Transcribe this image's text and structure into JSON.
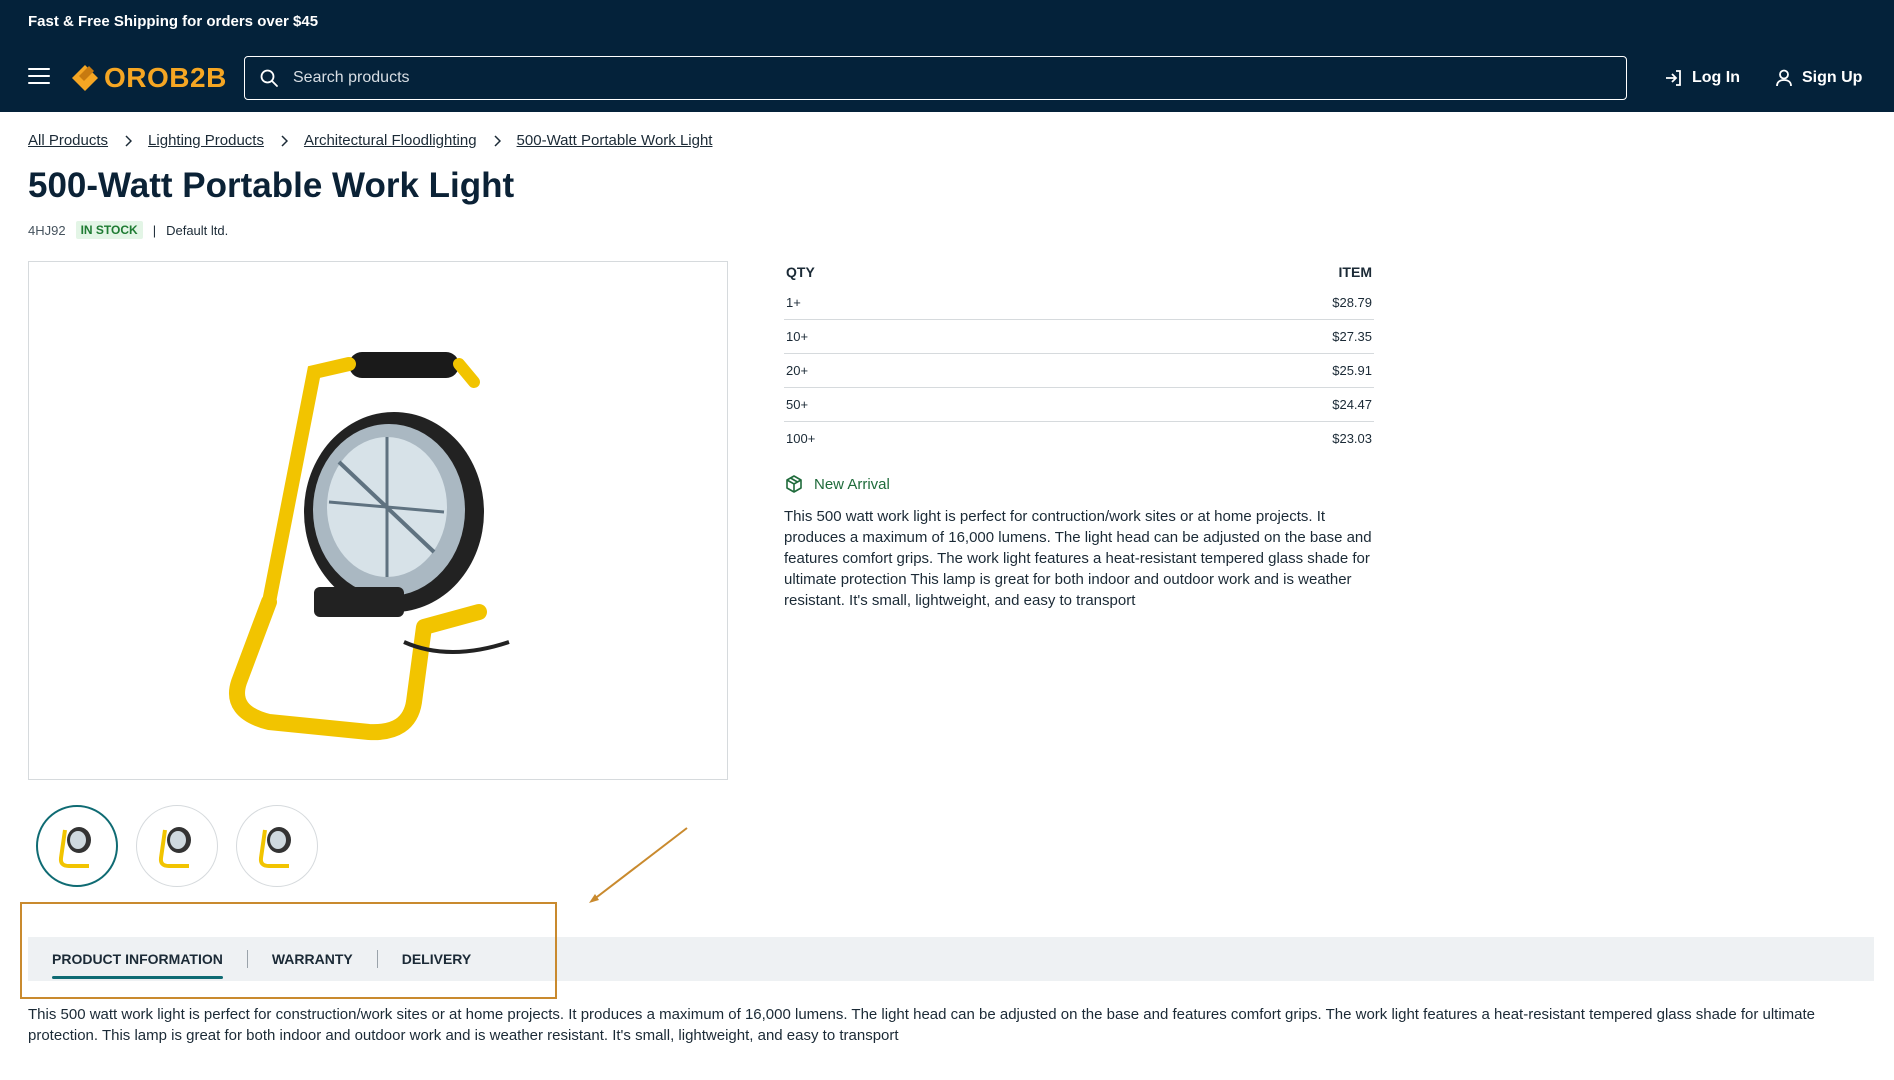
{
  "header": {
    "promo": "Fast & Free Shipping for orders over $45",
    "logo_text": "OROB2B",
    "search_placeholder": "Search products",
    "login_label": "Log In",
    "signup_label": "Sign Up"
  },
  "breadcrumb": [
    "All Products",
    "Lighting Products",
    "Architectural Floodlighting",
    "500-Watt Portable Work Light"
  ],
  "product": {
    "title": "500-Watt Portable Work Light",
    "sku": "4HJ92",
    "stock": "IN STOCK",
    "owner": "Default ltd.",
    "new_arrival": "New Arrival",
    "short_description": "This 500 watt work light is perfect for contruction/work sites or at home projects. It produces a maximum of 16,000 lumens. The light head can be adjusted on the base and features comfort grips. The work light features a heat-resistant tempered glass shade for ultimate protection This lamp is great for both indoor and outdoor work and is weather resistant. It's small, lightweight, and easy to transport",
    "long_description": "This 500 watt work light is perfect for construction/work sites or at home projects. It produces a maximum of 16,000 lumens. The light head can be adjusted on the base and features comfort grips. The work light features a heat-resistant tempered glass shade for ultimate protection. This lamp is great for both indoor and outdoor work and is weather resistant. It's small, lightweight, and easy to transport"
  },
  "prices": {
    "qty_header": "QTY",
    "item_header": "ITEM",
    "rows": [
      {
        "qty": "1+",
        "price": "$28.79"
      },
      {
        "qty": "10+",
        "price": "$27.35"
      },
      {
        "qty": "20+",
        "price": "$25.91"
      },
      {
        "qty": "50+",
        "price": "$24.47"
      },
      {
        "qty": "100+",
        "price": "$23.03"
      }
    ]
  },
  "tabs": [
    "PRODUCT INFORMATION",
    "WARRANTY",
    "DELIVERY"
  ],
  "colors": {
    "header_bg": "#04223a",
    "logo": "#f5a623",
    "accent": "#0f6b73",
    "in_stock": "#1e7b32",
    "annotation": "#c98a2e"
  }
}
